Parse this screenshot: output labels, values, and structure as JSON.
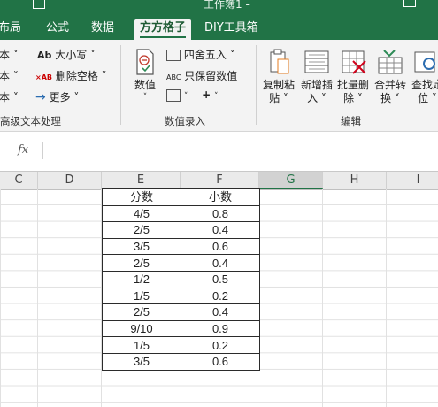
{
  "title_bar": {
    "title": "工作簿1 -"
  },
  "tabs": [
    {
      "label": "布局"
    },
    {
      "label": "公式"
    },
    {
      "label": "数据"
    },
    {
      "label": "方方格子"
    },
    {
      "label": "DIY工具箱"
    }
  ],
  "ribbon": {
    "left_items": [
      "本 ˅",
      "本 ˅",
      "本 ˅"
    ],
    "left_group_label": "高级文本处理",
    "text_tools": {
      "case_label": "大小写 ˅",
      "case_icon": "Ab",
      "delete_space_label": "删除空格 ˅",
      "delete_space_icon": "×AB",
      "more_label": "更多 ˅"
    },
    "numeric_group": {
      "numeric_button_label": "数值",
      "round_label": "四舍五入 ˅",
      "keep_numeric_label": "只保留数值",
      "keep_numeric_icon": "ABC",
      "group_label": "数值录入"
    },
    "edit_group": {
      "buttons": [
        {
          "label_line1": "复制粘",
          "label_line2": "贴 ˅"
        },
        {
          "label_line1": "新增插",
          "label_line2": "入 ˅"
        },
        {
          "label_line1": "批量删",
          "label_line2": "除 ˅"
        },
        {
          "label_line1": "合并转",
          "label_line2": "换 ˅"
        },
        {
          "label_line1": "查找定",
          "label_line2": "位 ˅"
        }
      ],
      "group_label": "编辑"
    }
  },
  "formula_bar": {
    "fx_label": "fx",
    "value": ""
  },
  "columns": [
    "C",
    "D",
    "E",
    "F",
    "G",
    "H",
    "I"
  ],
  "selected_column": "G",
  "table": {
    "headers": [
      "分数",
      "小数"
    ],
    "rows": [
      [
        "4/5",
        "0.8"
      ],
      [
        "2/5",
        "0.4"
      ],
      [
        "3/5",
        "0.6"
      ],
      [
        "2/5",
        "0.4"
      ],
      [
        "1/2",
        "0.5"
      ],
      [
        "1/5",
        "0.2"
      ],
      [
        "2/5",
        "0.4"
      ],
      [
        "9/10",
        "0.9"
      ],
      [
        "1/5",
        "0.2"
      ],
      [
        "3/5",
        "0.6"
      ]
    ]
  }
}
